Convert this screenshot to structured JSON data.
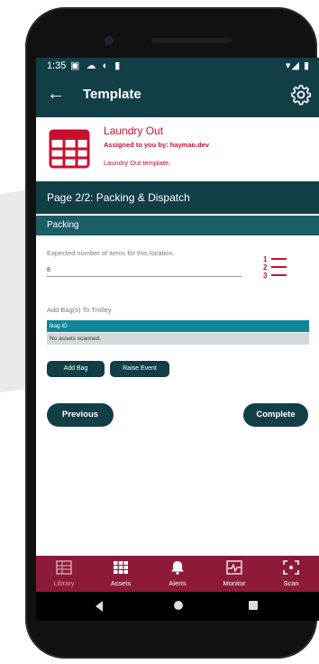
{
  "status_bar": {
    "time": "1:35",
    "left_icons": "▣ ☁ ◐ ▮",
    "right_icons": "▾◢ ▮"
  },
  "app_bar": {
    "title": "Template",
    "back_icon": "arrow-left-icon",
    "settings_icon": "gear-icon"
  },
  "template": {
    "title": "Laundry Out",
    "assigned": "Assigned to you by: hayman.dev",
    "description": "Laundry Out template."
  },
  "page": {
    "label": "Page 2/2: Packing & Dispatch"
  },
  "section": {
    "label": "Packing"
  },
  "form": {
    "expected_label": "Expected number of items for this location.",
    "expected_value": "8",
    "bag_label": "Add Bag(s) To Trolley",
    "bag_table_header": "Bag ID",
    "bag_empty_text": "No assets scanned."
  },
  "buttons": {
    "add_bag": "Add Bag",
    "raise_event": "Raise Event",
    "previous": "Previous",
    "complete": "Complete"
  },
  "bottom_nav": [
    {
      "label": "Library",
      "icon": "library-icon"
    },
    {
      "label": "Assets",
      "icon": "assets-grid-icon"
    },
    {
      "label": "Alerts",
      "icon": "bell-icon"
    },
    {
      "label": "Monitor",
      "icon": "monitor-icon"
    },
    {
      "label": "Scan",
      "icon": "scan-icon"
    }
  ],
  "colors": {
    "primary": "#123f46",
    "accent": "#c8102e",
    "nav": "#8e1a3a",
    "table_header": "#0f8797"
  }
}
